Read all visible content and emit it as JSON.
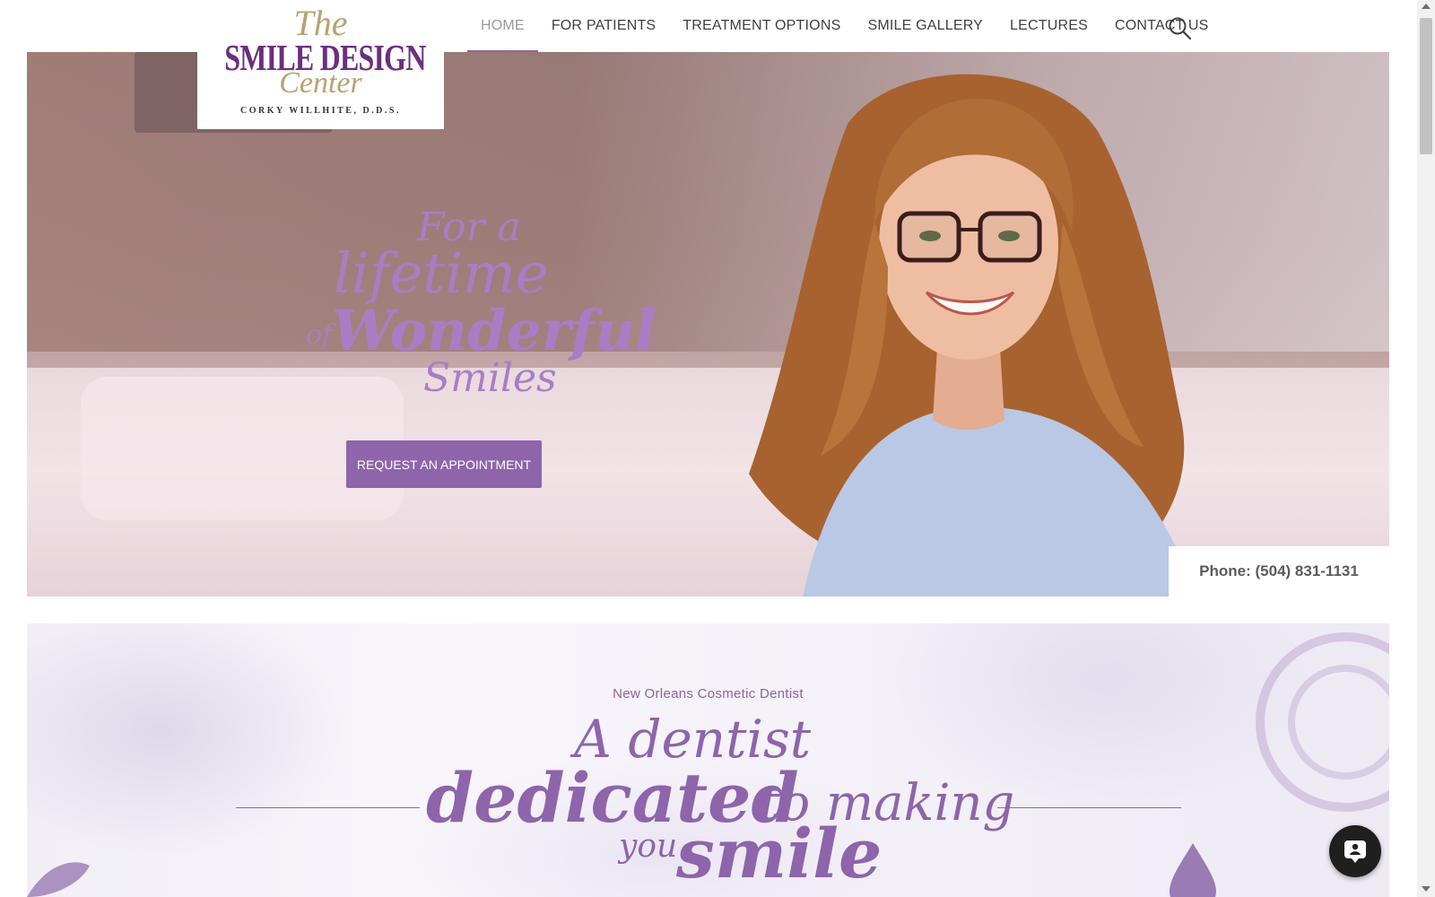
{
  "logo": {
    "the": "The",
    "main": "SMILE DESIGN",
    "center": "Center",
    "subtitle": "CORKY WILLHITE, D.D.S."
  },
  "nav": {
    "items": [
      {
        "label": "HOME",
        "active": true
      },
      {
        "label": "FOR PATIENTS",
        "active": false
      },
      {
        "label": "TREATMENT OPTIONS",
        "active": false
      },
      {
        "label": "SMILE GALLERY",
        "active": false
      },
      {
        "label": "LECTURES",
        "active": false
      },
      {
        "label": "CONTACT US",
        "active": false
      }
    ],
    "search_icon": "search-icon"
  },
  "hero": {
    "slogan": {
      "line1": "For a",
      "line2": "lifetime",
      "line3_small": "of",
      "line3_big": "Wonderful",
      "line4": "Smiles"
    },
    "cta_label": "REQUEST AN APPOINTMENT",
    "phone": "Phone: (504) 831-1131"
  },
  "intro": {
    "kicker": "New Orleans Cosmetic Dentist",
    "line1": "A dentist",
    "dedicated": "dedicated",
    "to_making": "to making",
    "you": "you",
    "smile": "smile"
  },
  "chat": {
    "icon": "chat-bubble-icon"
  },
  "colors": {
    "accent": "#8e64ab",
    "slogan": "#a97dc6",
    "logo_purple": "#6b2f7e",
    "logo_gold": "#b9a172"
  }
}
